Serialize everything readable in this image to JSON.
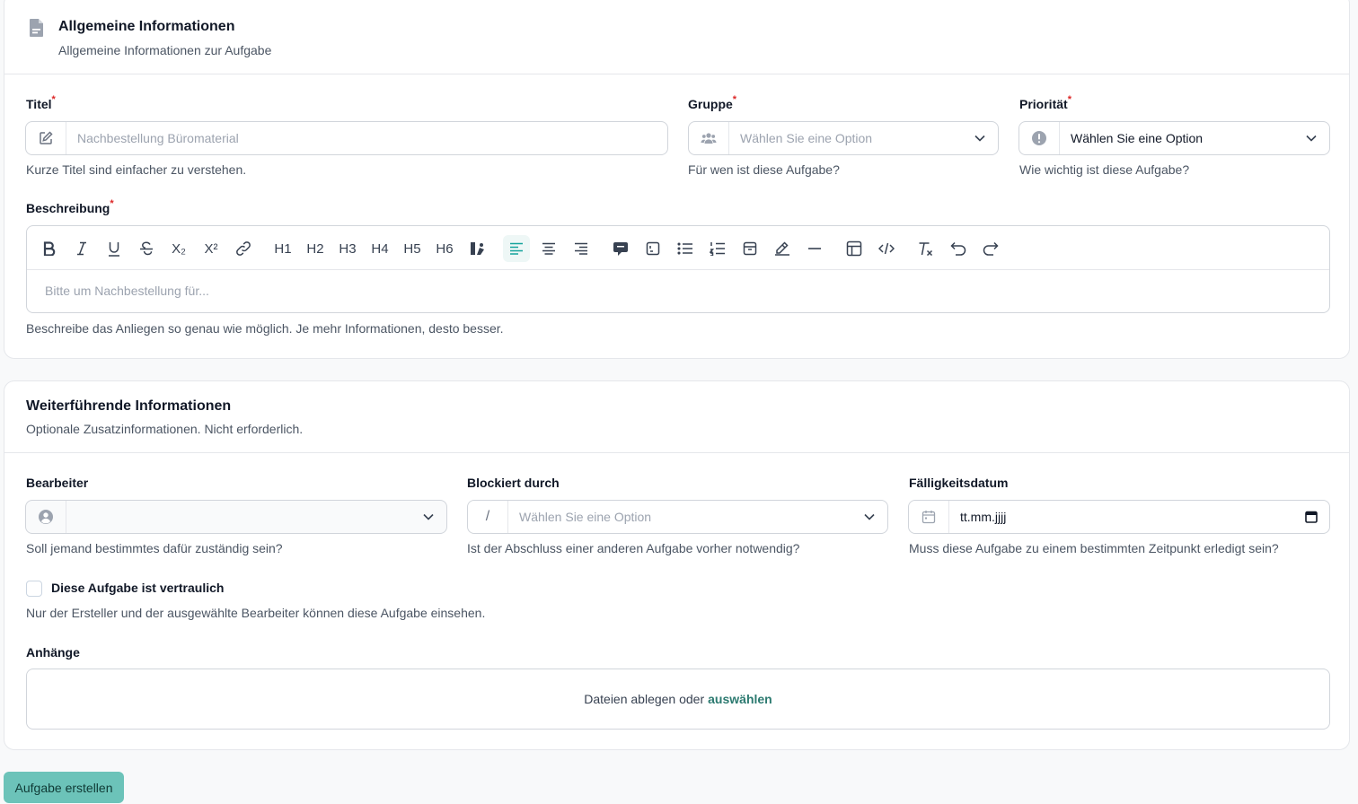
{
  "general": {
    "title": "Allgemeine Informationen",
    "subtitle": "Allgemeine Informationen zur Aufgabe"
  },
  "titel": {
    "label": "Titel",
    "required": "*",
    "placeholder": "Nachbestellung Büromaterial",
    "hint": "Kurze Titel sind einfacher zu verstehen."
  },
  "gruppe": {
    "label": "Gruppe",
    "required": "*",
    "value": "Wählen Sie eine Option",
    "hint": "Für wen ist diese Aufgabe?"
  },
  "prioritaet": {
    "label": "Priorität",
    "required": "*",
    "value": "Wählen Sie eine Option",
    "hint": "Wie wichtig ist diese Aufgabe?"
  },
  "beschreibung": {
    "label": "Beschreibung",
    "required": "*",
    "placeholder": "Bitte um Nachbestellung für...",
    "hint": "Beschreibe das Anliegen so genau wie möglich. Je mehr Informationen, desto besser.",
    "toolbar": {
      "headings": [
        "H1",
        "H2",
        "H3",
        "H4",
        "H5",
        "H6"
      ],
      "subscript": "X₂",
      "superscript": "X²",
      "active_tool": "align-left"
    }
  },
  "further": {
    "title": "Weiterführende Informationen",
    "subtitle": "Optionale Zusatzinformationen. Nicht erforderlich."
  },
  "bearbeiter": {
    "label": "Bearbeiter",
    "value": "",
    "hint": "Soll jemand bestimmtes dafür zuständig sein?"
  },
  "blockiert": {
    "label": "Blockiert durch",
    "prefix": "/",
    "value": "Wählen Sie eine Option",
    "hint": "Ist der Abschluss einer anderen Aufgabe vorher notwendig?"
  },
  "faellig": {
    "label": "Fälligkeitsdatum",
    "value": "tt.mm.jjjj",
    "hint": "Muss diese Aufgabe zu einem bestimmten Zeitpunkt erledigt sein?"
  },
  "vertraulich": {
    "label": "Diese Aufgabe ist vertraulich",
    "checked": false,
    "hint": "Nur der Ersteller und der ausgewählte Bearbeiter können diese Aufgabe einsehen."
  },
  "anhaenge": {
    "label": "Anhänge",
    "drop_text": "Dateien ablegen oder",
    "select_link": "auswählen"
  },
  "submit": {
    "label": "Aufgabe erstellen"
  },
  "colors": {
    "accent": "#6cc3b9",
    "link": "#2c7a70",
    "required": "#dc2626"
  }
}
